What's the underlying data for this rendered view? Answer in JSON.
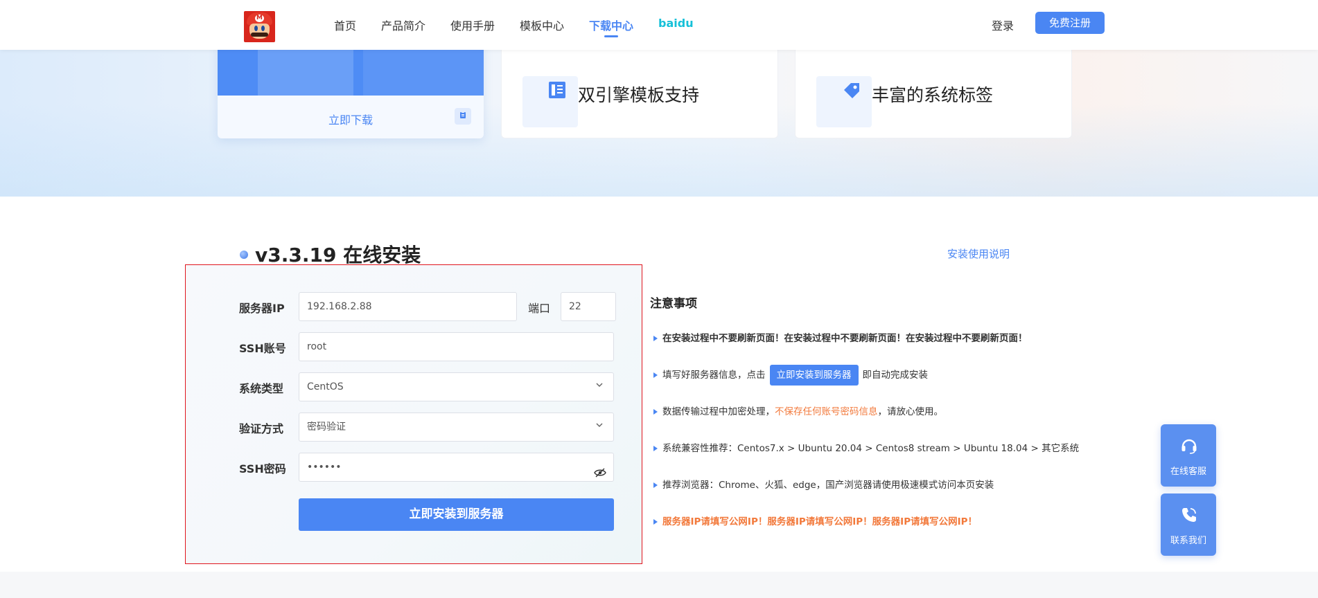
{
  "nav": {
    "logo_text": "M",
    "items": [
      "首页",
      "产品简介",
      "使用手册",
      "模板中心",
      "下载中心",
      "baidu"
    ],
    "active_index": 4,
    "login": "登录",
    "register": "免费注册"
  },
  "features": {
    "download_label": "立即下载",
    "cards": [
      "双引擎模板支持",
      "丰富的系统标签"
    ]
  },
  "section": {
    "title": "v3.3.19 在线安装",
    "help_link": "安装使用说明"
  },
  "form": {
    "server_ip_label": "服务器IP",
    "server_ip_value": "192.168.2.88",
    "port_label": "端口",
    "port_value": "22",
    "ssh_account_label": "SSH账号",
    "ssh_account_value": "root",
    "os_label": "系统类型",
    "os_value": "CentOS",
    "auth_label": "验证方式",
    "auth_value": "密码验证",
    "ssh_password_label": "SSH密码",
    "ssh_password_value": "••••••",
    "submit": "立即安装到服务器"
  },
  "notes": {
    "title": "注意事项",
    "n1": "在安装过程中不要刷新页面！在安装过程中不要刷新页面！在安装过程中不要刷新页面！",
    "n2_pre": "填写好服务器信息，点击",
    "n2_btn": "立即安装到服务器",
    "n2_post": "即自动完成安装",
    "n3_pre": "数据传输过程中加密处理，",
    "n3_warn": "不保存任何账号密码信息",
    "n3_post": "，请放心使用。",
    "n4": "系统兼容性推荐：Centos7.x > Ubuntu 20.04 > Centos8 stream > Ubuntu 18.04 > 其它系统",
    "n5": "推荐浏览器：Chrome、火狐、edge，国产浏览器请使用极速模式访问本页安装",
    "n6": "服务器IP请填写公网IP！服务器IP请填写公网IP！服务器IP请填写公网IP！"
  },
  "side": {
    "service": "在线客服",
    "contact": "联系我们"
  },
  "colors": {
    "accent": "#4a86f3",
    "warning": "#f2793b",
    "highlight_border": "#e0141c",
    "baidu": "#16c0d8"
  }
}
